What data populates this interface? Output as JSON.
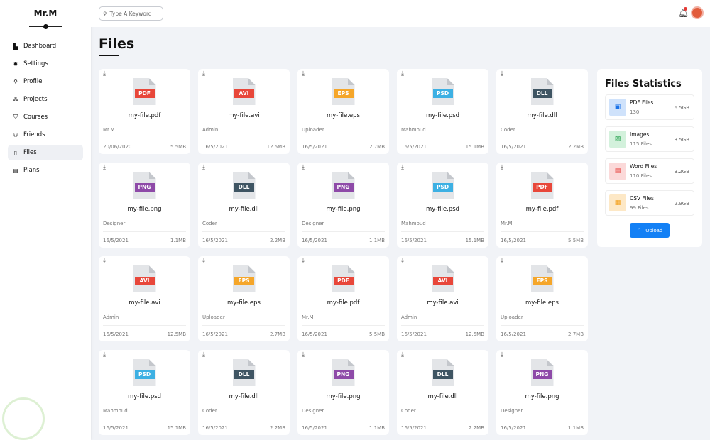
{
  "sidebar": {
    "brand": "Mr.M",
    "items": [
      {
        "label": "Dashboard",
        "icon": "chart-icon",
        "glyph": "▙"
      },
      {
        "label": "Settings",
        "icon": "gear-icon",
        "glyph": "✹"
      },
      {
        "label": "Profile",
        "icon": "user-icon",
        "glyph": "⚲"
      },
      {
        "label": "Projects",
        "icon": "diagram-icon",
        "glyph": "⁂"
      },
      {
        "label": "Courses",
        "icon": "graduation-cap-icon",
        "glyph": "⛉"
      },
      {
        "label": "Friends",
        "icon": "users-icon",
        "glyph": "⚇"
      },
      {
        "label": "Files",
        "icon": "file-icon",
        "glyph": "▯",
        "active": true
      },
      {
        "label": "Plans",
        "icon": "credit-card-icon",
        "glyph": "▤"
      }
    ]
  },
  "header": {
    "search_placeholder": "Type A Keyword"
  },
  "page": {
    "title": "Files"
  },
  "colors": {
    "PDF": "#e8473a",
    "AVI": "#e8473a",
    "EPS": "#f5a62a",
    "PSD": "#3db0e3",
    "DLL": "#3f5563",
    "PNG": "#8e4aa8"
  },
  "files": [
    {
      "type": "PDF",
      "name": "my-file.pdf",
      "owner": "Mr.M",
      "date": "20/06/2020",
      "size": "5.5MB"
    },
    {
      "type": "AVI",
      "name": "my-file.avi",
      "owner": "Admin",
      "date": "16/5/2021",
      "size": "12.5MB"
    },
    {
      "type": "EPS",
      "name": "my-file.eps",
      "owner": "Uploader",
      "date": "16/5/2021",
      "size": "2.7MB"
    },
    {
      "type": "PSD",
      "name": "my-file.psd",
      "owner": "Mahmoud",
      "date": "16/5/2021",
      "size": "15.1MB"
    },
    {
      "type": "DLL",
      "name": "my-file.dll",
      "owner": "Coder",
      "date": "16/5/2021",
      "size": "2.2MB"
    },
    {
      "type": "PNG",
      "name": "my-file.png",
      "owner": "Designer",
      "date": "16/5/2021",
      "size": "1.1MB"
    },
    {
      "type": "DLL",
      "name": "my-file.dll",
      "owner": "Coder",
      "date": "16/5/2021",
      "size": "2.2MB"
    },
    {
      "type": "PNG",
      "name": "my-file.png",
      "owner": "Designer",
      "date": "16/5/2021",
      "size": "1.1MB"
    },
    {
      "type": "PSD",
      "name": "my-file.psd",
      "owner": "Mahmoud",
      "date": "16/5/2021",
      "size": "15.1MB"
    },
    {
      "type": "PDF",
      "name": "my-file.pdf",
      "owner": "Mr.M",
      "date": "16/5/2021",
      "size": "5.5MB"
    },
    {
      "type": "AVI",
      "name": "my-file.avi",
      "owner": "Admin",
      "date": "16/5/2021",
      "size": "12.5MB"
    },
    {
      "type": "EPS",
      "name": "my-file.eps",
      "owner": "Uploader",
      "date": "16/5/2021",
      "size": "2.7MB"
    },
    {
      "type": "PDF",
      "name": "my-file.pdf",
      "owner": "Mr.M",
      "date": "16/5/2021",
      "size": "5.5MB"
    },
    {
      "type": "AVI",
      "name": "my-file.avi",
      "owner": "Admin",
      "date": "16/5/2021",
      "size": "12.5MB"
    },
    {
      "type": "EPS",
      "name": "my-file.eps",
      "owner": "Uploader",
      "date": "16/5/2021",
      "size": "2.7MB"
    },
    {
      "type": "PSD",
      "name": "my-file.psd",
      "owner": "Mahmoud",
      "date": "16/5/2021",
      "size": "15.1MB"
    },
    {
      "type": "DLL",
      "name": "my-file.dll",
      "owner": "Coder",
      "date": "16/5/2021",
      "size": "2.2MB"
    },
    {
      "type": "PNG",
      "name": "my-file.png",
      "owner": "Designer",
      "date": "16/5/2021",
      "size": "1.1MB"
    },
    {
      "type": "DLL",
      "name": "my-file.dll",
      "owner": "Coder",
      "date": "16/5/2021",
      "size": "2.2MB"
    },
    {
      "type": "PNG",
      "name": "my-file.png",
      "owner": "Designer",
      "date": "16/5/2021",
      "size": "1.1MB"
    }
  ],
  "stats": {
    "title": "Files Statistics",
    "items": [
      {
        "label": "PDF Files",
        "count": "130",
        "size": "6.5GB",
        "bg": "#cfe2fb",
        "fg": "#1a73e8"
      },
      {
        "label": "Images",
        "count": "115 Files",
        "size": "3.5GB",
        "bg": "#d3f1dc",
        "fg": "#22a04b"
      },
      {
        "label": "Word Files",
        "count": "110 Files",
        "size": "3.2GB",
        "bg": "#fbd9d9",
        "fg": "#e53935"
      },
      {
        "label": "CSV Files",
        "count": "99 Files",
        "size": "2.9GB",
        "bg": "#fde8c6",
        "fg": "#f39c12"
      }
    ],
    "upload_label": "Upload"
  }
}
